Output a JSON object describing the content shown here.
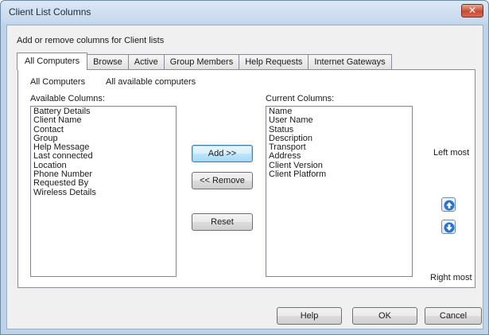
{
  "window": {
    "title": "Client List Columns",
    "close_glyph": "✕"
  },
  "instruction": "Add or remove columns for Client lists",
  "tabs": [
    {
      "label": "All Computers",
      "active": true
    },
    {
      "label": "Browse"
    },
    {
      "label": "Active"
    },
    {
      "label": "Group Members"
    },
    {
      "label": "Help Requests"
    },
    {
      "label": "Internet Gateways"
    }
  ],
  "scope": {
    "name": "All Computers",
    "description": "All available computers"
  },
  "available": {
    "label": "Available Columns:",
    "items": [
      "Battery Details",
      "Client Name",
      "Contact",
      "Group",
      "Help Message",
      "Last connected",
      "Location",
      "Phone Number",
      "Requested By",
      "Wireless Details"
    ]
  },
  "current": {
    "label": "Current Columns:",
    "items": [
      "Name",
      "User Name",
      "Status",
      "Description",
      "Transport",
      "Address",
      "Client Version",
      "Client Platform"
    ]
  },
  "actions": {
    "add": "Add >>",
    "remove": "<< Remove",
    "reset": "Reset"
  },
  "order": {
    "left_most": "Left most",
    "right_most": "Right most",
    "up_icon": "arrow-up-icon",
    "down_icon": "arrow-down-icon"
  },
  "footer": {
    "help": "Help",
    "ok": "OK",
    "cancel": "Cancel"
  },
  "colors": {
    "accent": "#1f6fc0",
    "close": "#c94a33"
  }
}
